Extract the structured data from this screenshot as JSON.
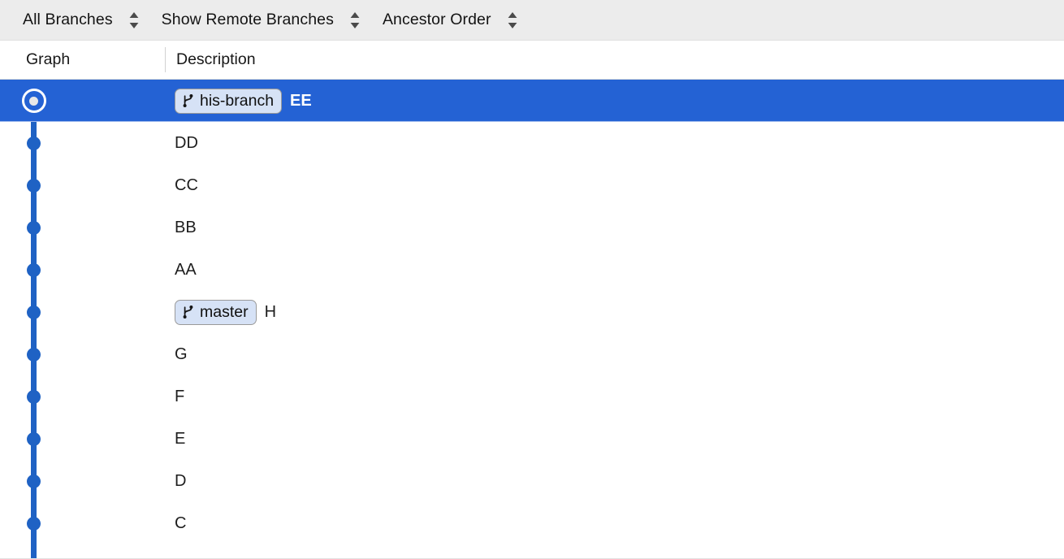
{
  "toolbar": {
    "controls": [
      {
        "label": "All Branches",
        "icon": "updown-stepper-icon"
      },
      {
        "label": "Show Remote Branches",
        "icon": "updown-stepper-icon"
      },
      {
        "label": "Ancestor Order",
        "icon": "updown-stepper-icon"
      }
    ]
  },
  "columns": {
    "graph": "Graph",
    "description": "Description"
  },
  "colors": {
    "selection": "#2462d4",
    "graph_line": "#1f62c4",
    "chip_background": "#d6e2f6",
    "chip_border": "#9a9a9a",
    "toolbar_background": "#ececec"
  },
  "commits": [
    {
      "description": "EE",
      "branch": "his-branch",
      "branch_icon": "git-branch-icon",
      "selected": true,
      "head": true
    },
    {
      "description": "DD",
      "branch": null,
      "selected": false,
      "head": false
    },
    {
      "description": "CC",
      "branch": null,
      "selected": false,
      "head": false
    },
    {
      "description": "BB",
      "branch": null,
      "selected": false,
      "head": false
    },
    {
      "description": "AA",
      "branch": null,
      "selected": false,
      "head": false
    },
    {
      "description": "H",
      "branch": "master",
      "branch_icon": "git-branch-icon",
      "selected": false,
      "head": false
    },
    {
      "description": "G",
      "branch": null,
      "selected": false,
      "head": false
    },
    {
      "description": "F",
      "branch": null,
      "selected": false,
      "head": false
    },
    {
      "description": "E",
      "branch": null,
      "selected": false,
      "head": false
    },
    {
      "description": "D",
      "branch": null,
      "selected": false,
      "head": false
    },
    {
      "description": "C",
      "branch": null,
      "selected": false,
      "head": false
    }
  ]
}
